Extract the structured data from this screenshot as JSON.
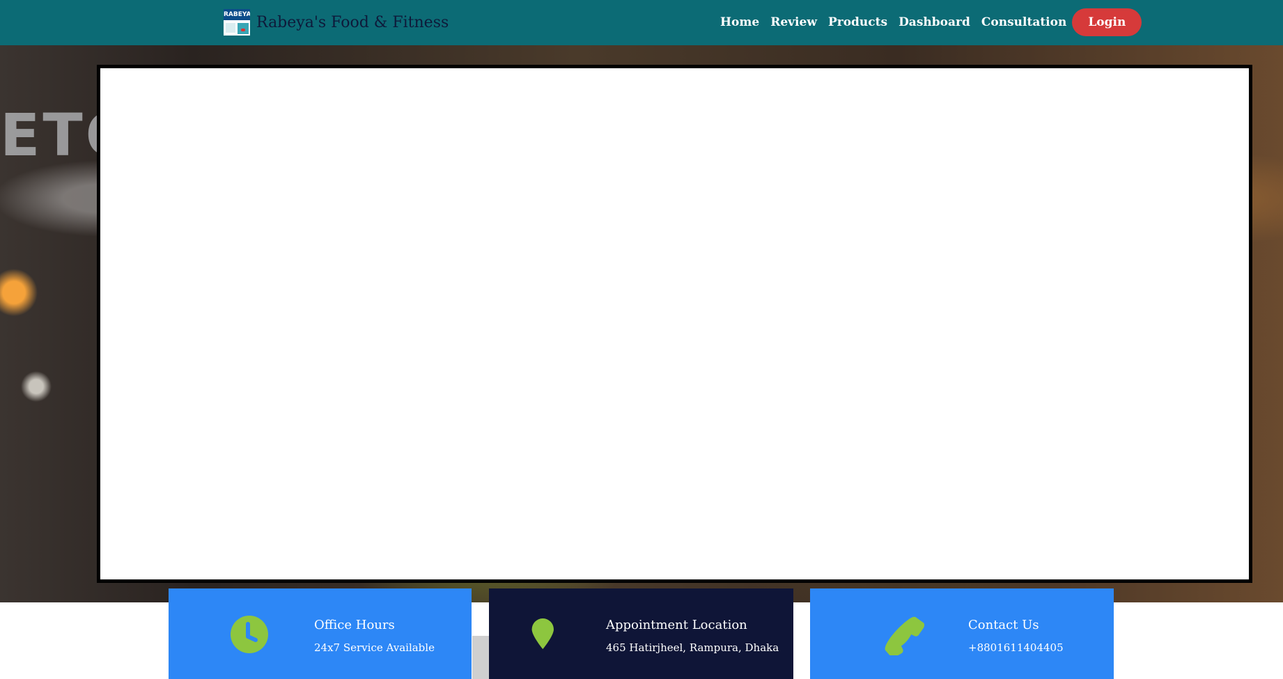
{
  "brand": {
    "logo_text": "RABEYA",
    "name": "Rabeya's Food & Fitness"
  },
  "nav": {
    "items": [
      "Home",
      "Review",
      "Products",
      "Dashboard",
      "Consultation"
    ],
    "login": "Login"
  },
  "hero": {
    "sign_text": "ETO"
  },
  "info_cards": [
    {
      "title": "Office Hours",
      "text": "24x7 Service Available",
      "icon": "clock-icon",
      "bg": "#2d87f6"
    },
    {
      "title": "Appointment Location",
      "text": "465 Hatirjheel, Rampura, Dhaka",
      "icon": "map-pin-icon",
      "bg": "#0f1537"
    },
    {
      "title": "Contact Us",
      "text": "+8801611404405",
      "icon": "phone-icon",
      "bg": "#2d87f6"
    }
  ],
  "colors": {
    "navbar": "#0c6b75",
    "login_button": "#d63a3a",
    "icon_green": "#8dc63f"
  }
}
